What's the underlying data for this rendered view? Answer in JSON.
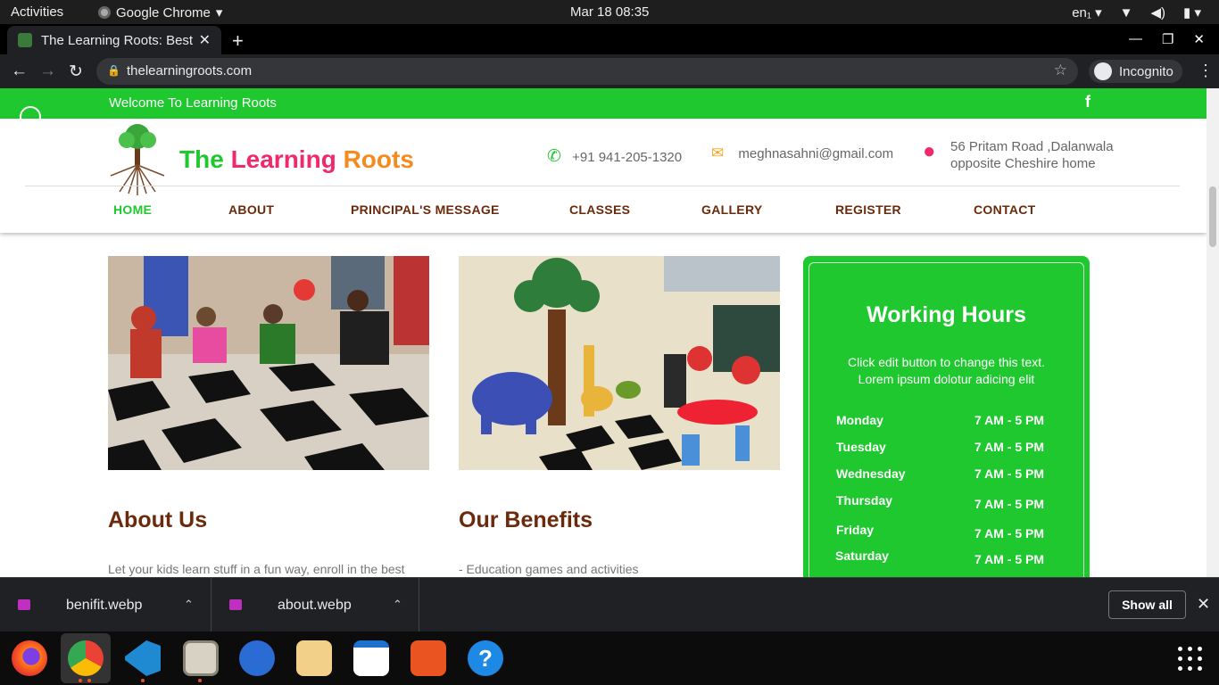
{
  "system": {
    "activities": "Activities",
    "app_name": "Google Chrome",
    "datetime": "Mar 18  08:35",
    "lang": "en₁"
  },
  "browser": {
    "tab_title": "The Learning Roots: Best",
    "url": "thelearningroots.com",
    "incognito_label": "Incognito"
  },
  "site": {
    "welcome": "Welcome To Learning Roots",
    "brand": {
      "part1": "The ",
      "part2": "Learning",
      "part3": " Roots"
    },
    "phone": "+91 941-205-1320",
    "email": "meghnasahni@gmail.com",
    "address_line1": "56 Pritam Road ,Dalanwala",
    "address_line2": "opposite Cheshire home",
    "menu": [
      "HOME",
      "ABOUT",
      "PRINCIPAL'S MESSAGE",
      "CLASSES",
      "GALLERY",
      "REGISTER",
      "CONTACT"
    ],
    "about": {
      "title": "About Us",
      "text": "Let your kids learn stuff in a fun way, enroll in the best"
    },
    "benefits": {
      "title": "Our Benefits",
      "text": "- Education games and activities"
    },
    "hours": {
      "title": "Working Hours",
      "desc_line1": "Click edit button to change this text.",
      "desc_line2": "Lorem ipsum dolotur adicing elit",
      "rows": [
        {
          "day": "Monday",
          "time": "7 AM - 5 PM"
        },
        {
          "day": "Tuesday",
          "time": "7 AM - 5 PM"
        },
        {
          "day": "Wednesday",
          "time": "7 AM - 5 PM"
        },
        {
          "day": "Thursday",
          "time": "7 AM - 5 PM"
        },
        {
          "day": "Friday",
          "time": "7 AM - 5 PM"
        },
        {
          "day": "Saturday",
          "time": "7 AM - 5 PM"
        }
      ]
    }
  },
  "downloads": {
    "items": [
      {
        "name": "benifit.webp"
      },
      {
        "name": "about.webp"
      }
    ],
    "show_all": "Show all"
  },
  "colors": {
    "green": "#1ec82e",
    "brown": "#6b2a0b",
    "pink": "#f0296b",
    "orange": "#f58a1f"
  }
}
